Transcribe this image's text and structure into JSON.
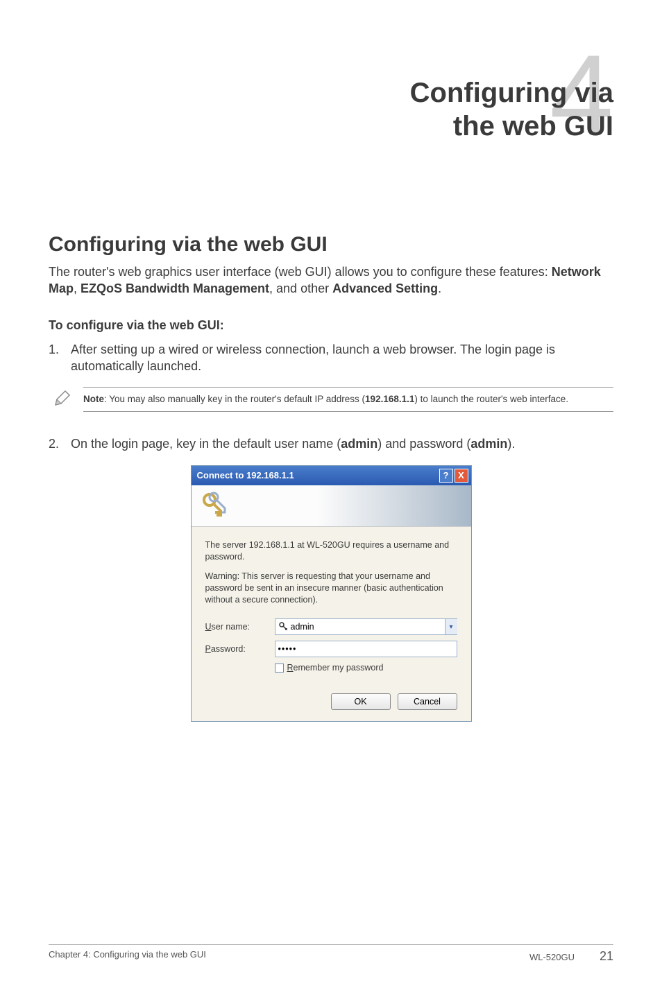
{
  "chapter": {
    "number": "4",
    "title_line1": "Configuring via",
    "title_line2": "the web GUI"
  },
  "section_heading": "Configuring via the web GUI",
  "intro": {
    "pre": "The router's web graphics user interface (web GUI) allows you to configure these features: ",
    "b1": "Network Map",
    "mid1": ", ",
    "b2": "EZQoS Bandwidth Management",
    "mid2": ", and other ",
    "b3": "Advanced Setting",
    "post": "."
  },
  "subhead": "To configure via the web GUI:",
  "step1": {
    "num": "1.",
    "text": "After setting up a wired or wireless connection, launch a web browser. The login page is automatically launched."
  },
  "note": {
    "bold": "Note",
    "text1": ": You may also manually key in the router's default IP address (",
    "ip": "192.168.1.1",
    "text2": ") to launch the router's web interface."
  },
  "step2": {
    "num": "2.",
    "pre": "On the login page, key in the default user name (",
    "b1": "admin",
    "mid": ") and password (",
    "b2": "admin",
    "post": ")."
  },
  "dialog": {
    "title": "Connect to 192.168.1.1",
    "help": "?",
    "close": "X",
    "msg1": "The server 192.168.1.1 at WL-520GU requires a username and password.",
    "msg2": "Warning: This server is requesting that your username and password be sent in an insecure manner (basic authentication without a secure connection).",
    "username_label_u": "U",
    "username_label_rest": "ser name:",
    "username_value": "admin",
    "password_label_u": "P",
    "password_label_rest": "assword:",
    "password_value": "•••••",
    "remember_u": "R",
    "remember_rest": "emember my password",
    "ok": "OK",
    "cancel": "Cancel"
  },
  "footer": {
    "left": "Chapter 4: Configuring via the web GUI",
    "model": "WL-520GU",
    "page": "21"
  }
}
